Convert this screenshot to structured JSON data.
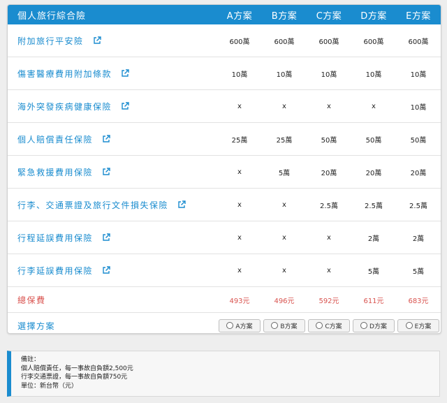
{
  "table": {
    "title": "個人旅行綜合險",
    "plans": [
      "A方案",
      "B方案",
      "C方案",
      "D方案",
      "E方案"
    ],
    "rows": [
      {
        "name": "附加旅行平安險",
        "values": [
          "600萬",
          "600萬",
          "600萬",
          "600萬",
          "600萬"
        ]
      },
      {
        "name": "傷害醫療費用附加條款",
        "values": [
          "10萬",
          "10萬",
          "10萬",
          "10萬",
          "10萬"
        ]
      },
      {
        "name": "海外突發疾病健康保險",
        "values": [
          "x",
          "x",
          "x",
          "x",
          "10萬"
        ]
      },
      {
        "name": "個人賠償責任保險",
        "values": [
          "25萬",
          "25萬",
          "50萬",
          "50萬",
          "50萬"
        ]
      },
      {
        "name": "緊急救援費用保險",
        "values": [
          "x",
          "5萬",
          "20萬",
          "20萬",
          "20萬"
        ]
      },
      {
        "name": "行李、交通票證及旅行文件損失保險",
        "values": [
          "x",
          "x",
          "2.5萬",
          "2.5萬",
          "2.5萬"
        ]
      },
      {
        "name": "行程延誤費用保險",
        "values": [
          "x",
          "x",
          "x",
          "2萬",
          "2萬"
        ]
      },
      {
        "name": "行李延誤費用保險",
        "values": [
          "x",
          "x",
          "x",
          "5萬",
          "5萬"
        ]
      }
    ],
    "total": {
      "label": "總保費",
      "values": [
        "493元",
        "496元",
        "592元",
        "611元",
        "683元"
      ]
    },
    "select": {
      "label": "選擇方案",
      "buttons": [
        "A方案",
        "B方案",
        "C方案",
        "D方案",
        "E方案"
      ]
    }
  },
  "notes": {
    "title": "備註：",
    "lines": [
      "個人賠償責任，每一事故自負額2,500元",
      "行李交通票證，每一事故自負額750元",
      "單位：新台幣（元）"
    ]
  },
  "colors": {
    "accent": "#1a8ccf",
    "price": "#d9534f"
  },
  "icons": {
    "row_link": "external-link-icon",
    "select": "radio-icon"
  }
}
